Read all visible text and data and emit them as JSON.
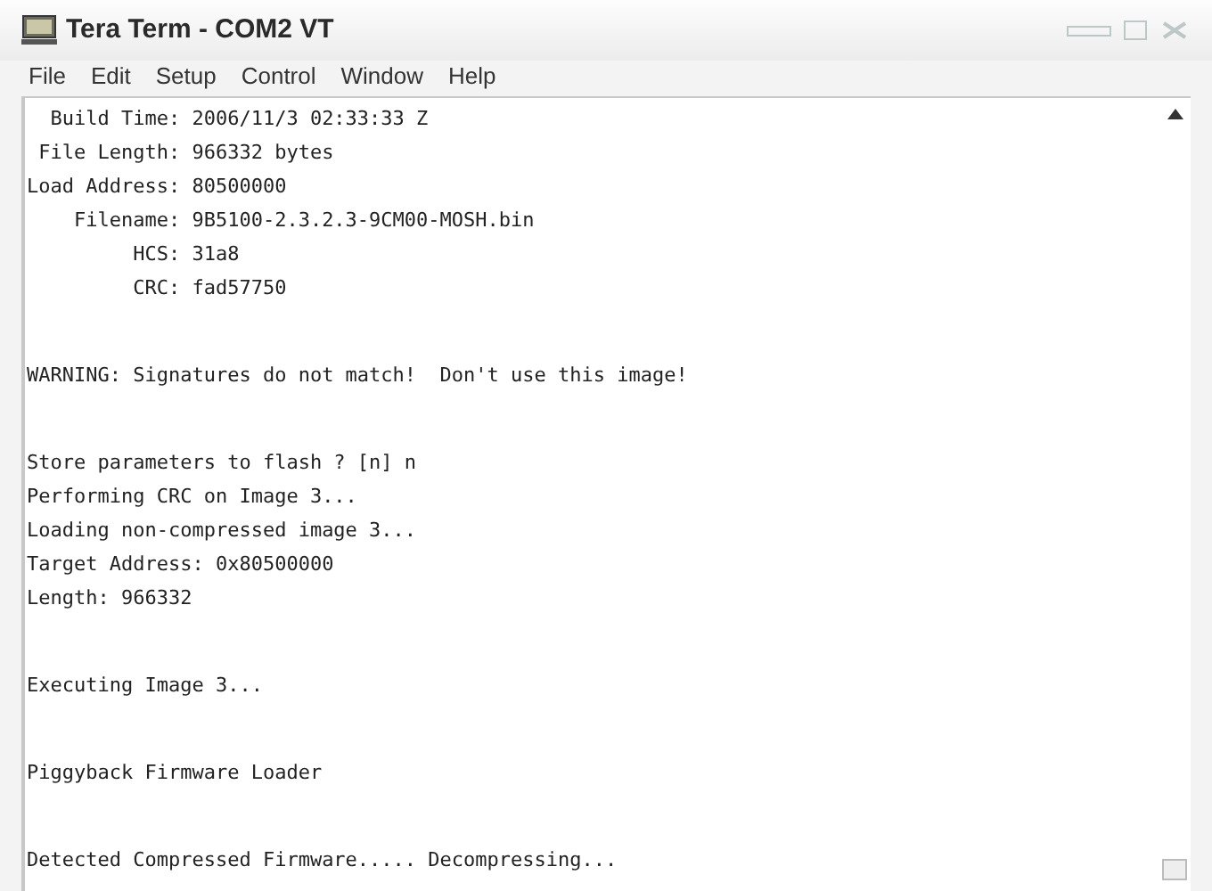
{
  "window": {
    "title": "Tera Term - COM2 VT"
  },
  "menu": [
    "File",
    "Edit",
    "Setup",
    "Control",
    "Window",
    "Help"
  ],
  "terminal": {
    "blocks": [
      [
        "  Build Time: 2006/11/3 02:33:33 Z",
        " File Length: 966332 bytes",
        "Load Address: 80500000",
        "    Filename: 9B5100-2.3.2.3-9CM00-MOSH.bin",
        "         HCS: 31a8",
        "         CRC: fad57750"
      ],
      [
        "WARNING: Signatures do not match!  Don't use this image!"
      ],
      [
        "Store parameters to flash ? [n] n",
        "Performing CRC on Image 3...",
        "Loading non-compressed image 3...",
        "Target Address: 0x80500000",
        "Length: 966332"
      ],
      [
        "Executing Image 3..."
      ],
      [
        "Piggyback Firmware Loader"
      ],
      [
        "Detected Compressed Firmware..... Decompressing..."
      ]
    ]
  }
}
